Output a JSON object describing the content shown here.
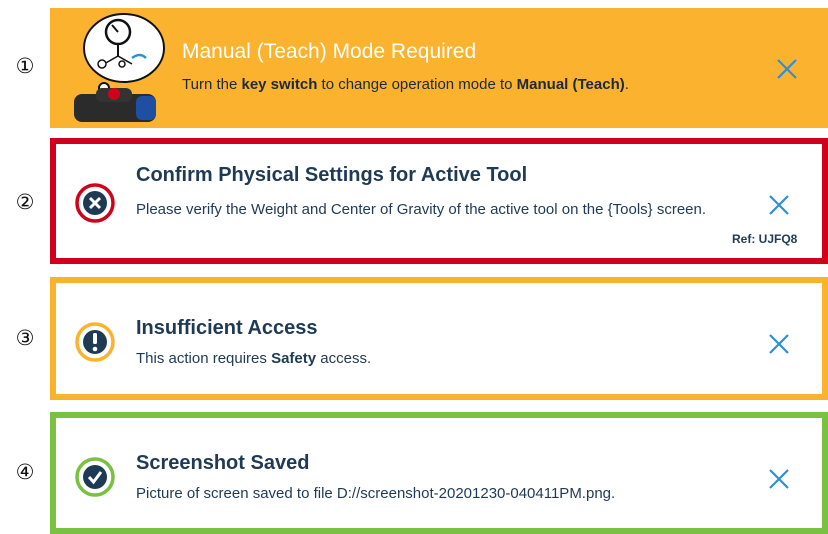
{
  "banners": [
    {
      "marker": "①",
      "title": "Manual (Teach) Mode Required",
      "message_pre": "Turn the ",
      "message_bold1": "key switch",
      "message_mid": " to change operation mode to ",
      "message_bold2": "Manual (Teach)",
      "message_post": ".",
      "close_icon": "close-icon",
      "color": "#fbb22e"
    },
    {
      "marker": "②",
      "title": "Confirm Physical Settings for Active Tool",
      "message": "Please verify the Weight and Center of Gravity of the active tool on the {Tools} screen.",
      "ref": "Ref: UJFQ8",
      "status_icon": "error-icon",
      "color": "#d0021b"
    },
    {
      "marker": "③",
      "title": "Insufficient Access",
      "message_pre": "This action requires ",
      "message_bold": "Safety",
      "message_post": " access.",
      "status_icon": "warning-icon",
      "color": "#fbb22e"
    },
    {
      "marker": "④",
      "title": "Screenshot Saved",
      "message": "Picture of screen saved to file D://screenshot-20201230-040411PM.png.",
      "status_icon": "success-icon",
      "color": "#7ac142"
    }
  ]
}
